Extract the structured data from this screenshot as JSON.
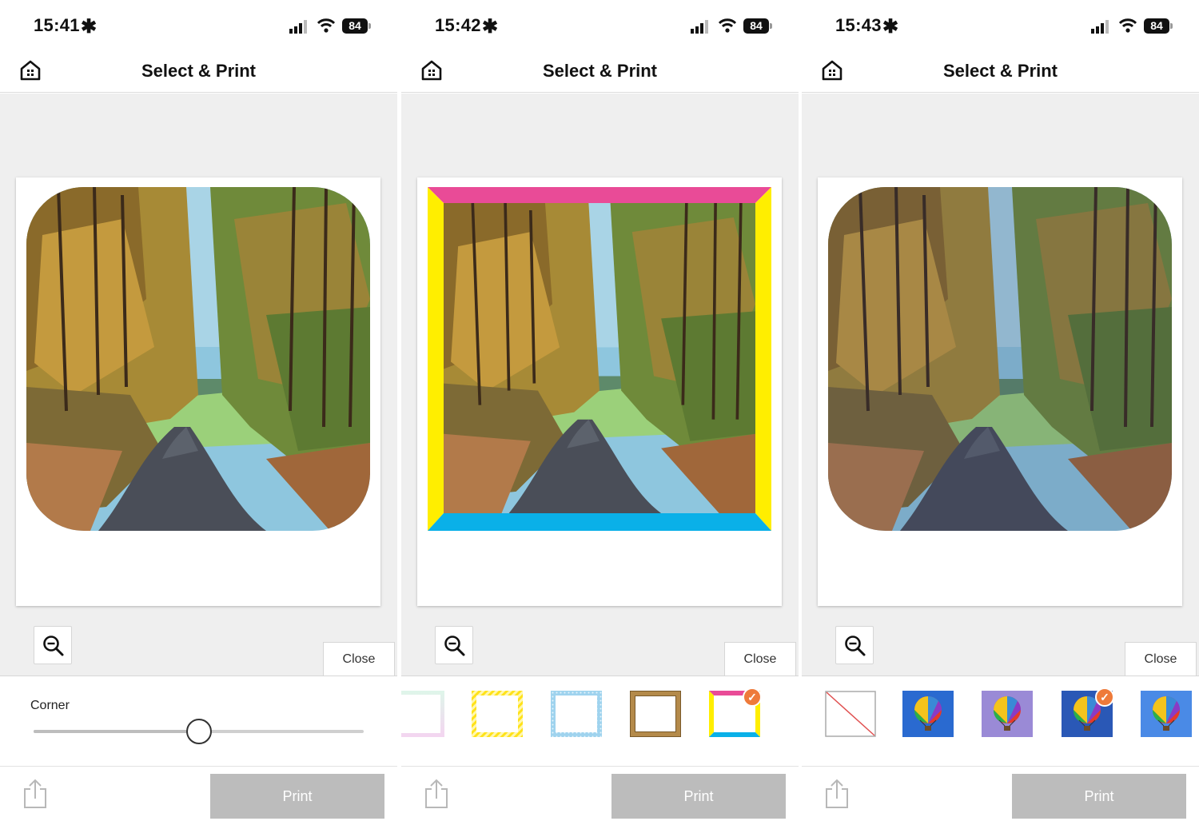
{
  "screens": [
    {
      "time": "15:41",
      "battery": "84",
      "title": "Select & Print",
      "close_label": "Close",
      "corner_label": "Corner",
      "corner_value": 0.5,
      "print_label": "Print"
    },
    {
      "time": "15:42",
      "battery": "84",
      "title": "Select & Print",
      "close_label": "Close",
      "print_label": "Print",
      "selected_frame": "cmy-frame"
    },
    {
      "time": "15:43",
      "battery": "84",
      "title": "Select & Print",
      "close_label": "Close",
      "print_label": "Print",
      "selected_filter": "filter-vivid"
    }
  ],
  "icons": {
    "status": [
      "star-icon",
      "signal-icon",
      "wifi-icon",
      "battery-icon"
    ],
    "nav": "home-icon",
    "zoom": "zoom-out-icon",
    "share": "share-icon",
    "selected": "checkmark-icon"
  },
  "frame_options": [
    "gradient-frame",
    "yellow-stripe-frame",
    "blue-dot-frame",
    "gold-wood-frame",
    "cmy-frame"
  ],
  "filter_options": [
    "no-filter",
    "filter-balloon-blue",
    "filter-balloon-violet",
    "filter-vivid",
    "filter-balloon-light"
  ],
  "colors": {
    "accent": "#ee7a3a",
    "print_disabled": "#bcbcbc",
    "canvas_bg": "#efefef",
    "frame_magenta": "#e94b97",
    "frame_yellow": "#ffee00",
    "frame_cyan": "#0ab0e8"
  }
}
